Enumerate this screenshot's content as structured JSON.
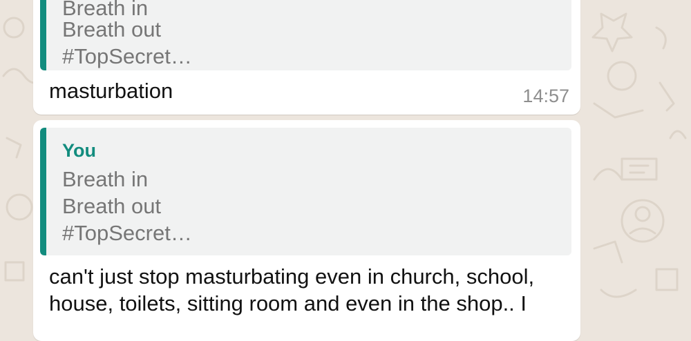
{
  "messages": [
    {
      "quote": {
        "lines": [
          "Breath in",
          "Breath out",
          "#TopSecret…"
        ]
      },
      "text": "masturbation",
      "time": "14:57"
    },
    {
      "quote": {
        "sender": "You",
        "lines": [
          "Breath in",
          "Breath out",
          "#TopSecret…"
        ]
      },
      "text_lines": [
        "can't just stop masturbating even in church, school,",
        "house, toilets, sitting room and even in the shop.. I"
      ]
    }
  ],
  "colors": {
    "chat_background": "#ece5dd",
    "bubble": "#ffffff",
    "quote_background": "#f1f2f2",
    "quote_accent": "#128c7e",
    "timestamp": "#8e8e8e"
  }
}
